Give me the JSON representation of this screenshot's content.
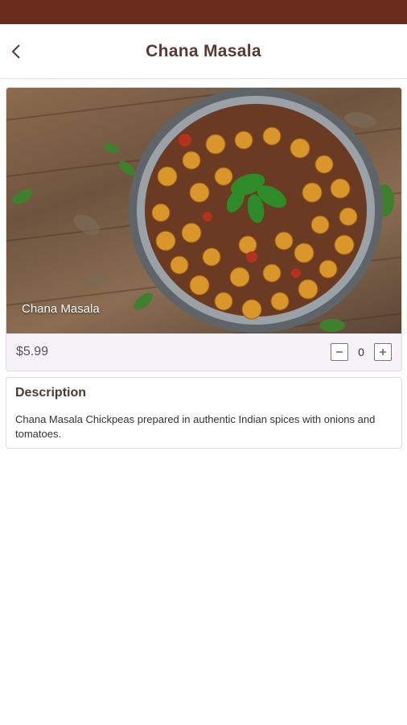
{
  "header": {
    "title": "Chana Masala",
    "back_icon": "chevron-left-icon"
  },
  "item": {
    "image_caption": "Chana Masala",
    "price": "$5.99",
    "quantity": "0",
    "decrement_icon": "minus-box-icon",
    "increment_icon": "plus-box-icon"
  },
  "description": {
    "title": "Description",
    "text": "Chana Masala Chickpeas prepared in authentic Indian spices with onions and tomatoes."
  },
  "colors": {
    "status_bar": "#6b2b1a",
    "title_text": "#5a3a30"
  }
}
